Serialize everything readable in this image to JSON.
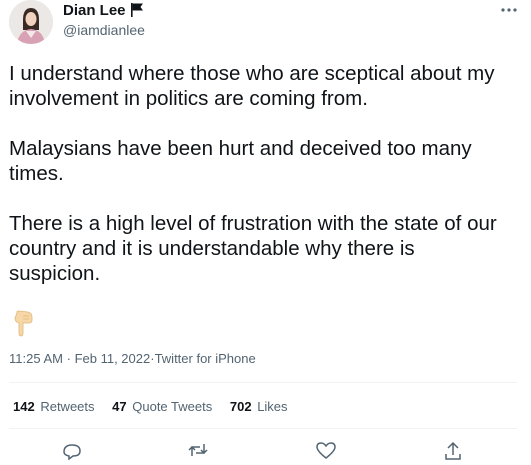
{
  "author": {
    "display_name": "Dian Lee",
    "handle": "@iamdianlee",
    "flag_icon": "black-flag-icon",
    "avatar_icon": "profile-photo-avatar"
  },
  "tweet": {
    "paragraphs": [
      "I understand where those who are sceptical about my",
      "involvement in politics are coming from.",
      "Malaysians have been hurt and deceived too many",
      "times.",
      "There is a high level of frustration with the state of our",
      "country and it is understandable why there is",
      "suspicion."
    ],
    "emoji": "pointing-down-hand-icon"
  },
  "meta": {
    "time": "11:25 AM",
    "separator": "·",
    "date": "Feb 11, 2022",
    "source": "Twitter for iPhone"
  },
  "stats": {
    "retweets_count": "142",
    "retweets_label": "Retweets",
    "quotes_count": "47",
    "quotes_label": "Quote Tweets",
    "likes_count": "702",
    "likes_label": "Likes"
  },
  "colors": {
    "text": "#0f1419",
    "secondary": "#536471",
    "divider": "#eff3f4"
  }
}
